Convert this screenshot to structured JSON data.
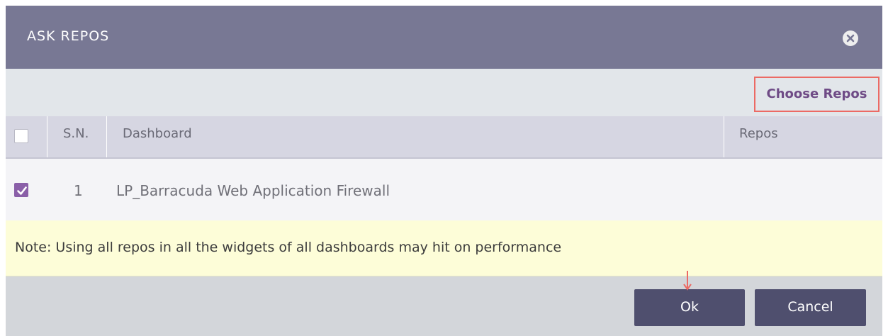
{
  "dialog": {
    "title": "ASK REPOS",
    "close_icon": "close-circle-icon"
  },
  "toolbar": {
    "choose_repos_label": "Choose Repos"
  },
  "table": {
    "headers": {
      "sn": "S.N.",
      "dashboard": "Dashboard",
      "repos": "Repos"
    },
    "rows": [
      {
        "checked": true,
        "sn": "1",
        "dashboard": "LP_Barracuda Web Application Firewall",
        "repos": ""
      }
    ]
  },
  "note": {
    "text": "Note: Using all repos in all the widgets of all dashboards may hit on performance"
  },
  "footer": {
    "ok_label": "Ok",
    "cancel_label": "Cancel"
  },
  "colors": {
    "header_bg": "#787894",
    "accent_purple": "#8a5fa8",
    "highlight_border": "#ec6a64",
    "button_bg": "#4f4f6e",
    "note_bg": "#fdfdd8"
  }
}
